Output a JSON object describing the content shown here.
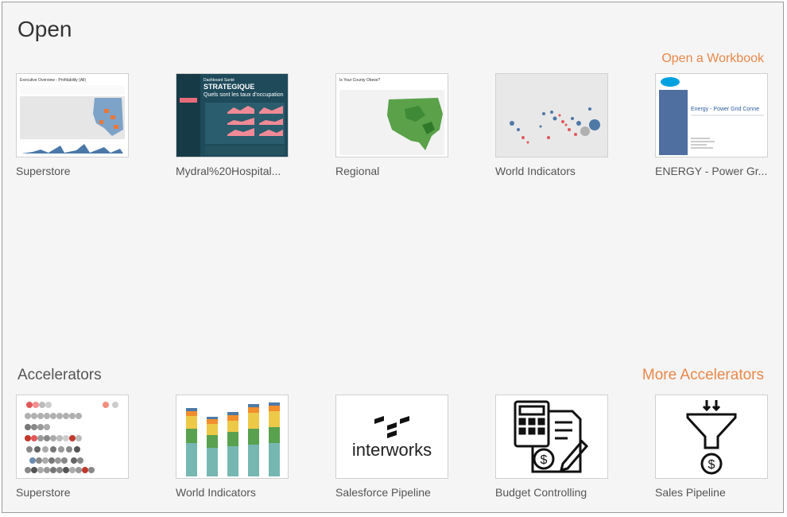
{
  "open": {
    "title": "Open",
    "open_workbook_link": "Open a Workbook",
    "recent_workbooks": [
      {
        "label": "Superstore",
        "thumb_icon": "executive-overview-dashboard"
      },
      {
        "label": "Mydral%20Hospital...",
        "thumb_icon": "hospital-dashboard"
      },
      {
        "label": "Regional",
        "thumb_icon": "us-map-dashboard"
      },
      {
        "label": "World Indicators",
        "thumb_icon": "bubble-map-dashboard"
      },
      {
        "label": "ENERGY - Power Gr...",
        "thumb_icon": "energy-report-dashboard"
      }
    ],
    "thumb_text": {
      "superstore_title": "Executive Overview - Profitability (All)",
      "hospital_header": "Dashboard Santé",
      "hospital_title": "STRATEGIQUE",
      "hospital_subtitle": "Quels sont les taux d'occupation",
      "regional_title": "Is Your County Obese?",
      "energy_title": "Energy - Power Grid Conne"
    }
  },
  "accelerators": {
    "title": "Accelerators",
    "more_link": "More Accelerators",
    "items": [
      {
        "label": "Superstore",
        "thumb_icon": "dot-strip-chart"
      },
      {
        "label": "World Indicators",
        "thumb_icon": "stacked-bar-chart"
      },
      {
        "label": "Salesforce Pipeline",
        "thumb_icon": "interworks-logo",
        "logo_text": "interworks"
      },
      {
        "label": "Budget Controlling",
        "thumb_icon": "budget-calculator-icon"
      },
      {
        "label": "Sales Pipeline",
        "thumb_icon": "sales-funnel-icon"
      }
    ]
  },
  "colors": {
    "accent": "#e8884a",
    "background": "#f5f5f5"
  }
}
